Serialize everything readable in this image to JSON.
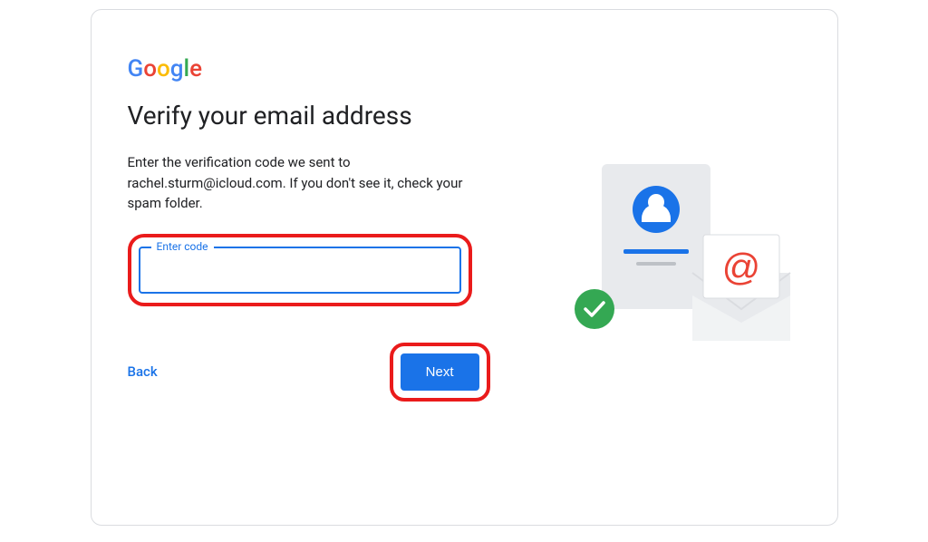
{
  "logo": {
    "g1": "G",
    "o1": "o",
    "o2": "o",
    "g2": "g",
    "l": "l",
    "e": "e"
  },
  "heading": "Verify your email address",
  "description": "Enter the verification code we sent to rachel.sturm@icloud.com. If you don't see it, check your spam folder.",
  "input": {
    "label": "Enter code",
    "value": ""
  },
  "buttons": {
    "back": "Back",
    "next": "Next"
  }
}
